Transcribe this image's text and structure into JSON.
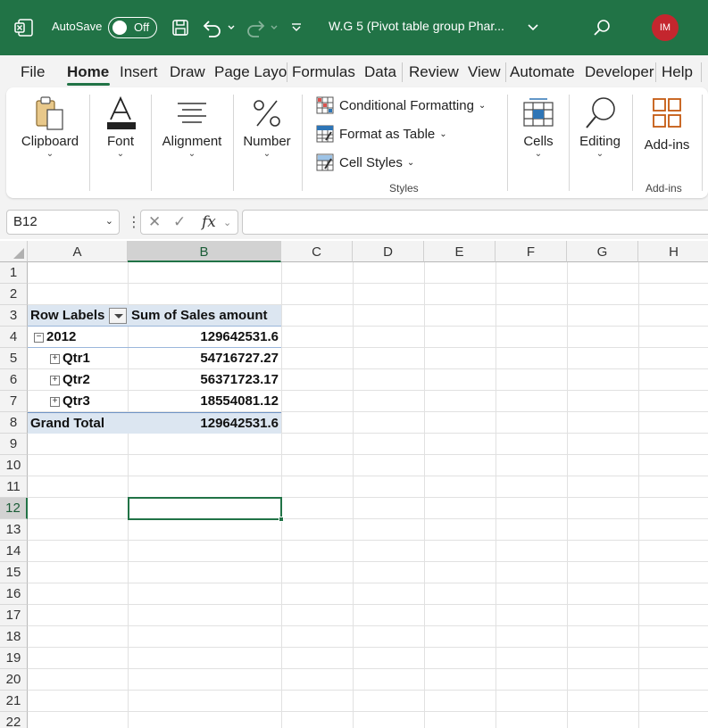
{
  "titlebar": {
    "autosave_label": "AutoSave",
    "autosave_state": "Off",
    "document_title": "W.G 5 (Pivot table group Phar...",
    "user_initials": "IM",
    "accent_color": "#217346",
    "avatar_color": "#c4262e"
  },
  "tabs": [
    "File",
    "Home",
    "Insert",
    "Draw",
    "Page Layo",
    "Formulas",
    "Data",
    "Review",
    "View",
    "Automate",
    "Developer",
    "Help"
  ],
  "active_tab": "Home",
  "ribbon": {
    "clipboard_label": "Clipboard",
    "font_label": "Font",
    "alignment_label": "Alignment",
    "number_label": "Number",
    "conditional_formatting_label": "Conditional Formatting",
    "format_as_table_label": "Format as Table",
    "cell_styles_label": "Cell Styles",
    "styles_group_label": "Styles",
    "cells_label": "Cells",
    "editing_label": "Editing",
    "addins_label": "Add-ins",
    "addins_group_label": "Add-ins"
  },
  "formula_bar": {
    "name_box": "B12",
    "fx_label": "fx",
    "formula": ""
  },
  "columns": [
    "A",
    "B",
    "C",
    "D",
    "E",
    "F",
    "G",
    "H"
  ],
  "selected_column": "B",
  "rows": [
    "1",
    "2",
    "3",
    "4",
    "5",
    "6",
    "7",
    "8",
    "9",
    "10",
    "11",
    "12",
    "13",
    "14",
    "15",
    "16",
    "17",
    "18",
    "19",
    "20",
    "21",
    "22"
  ],
  "selected_row": "12",
  "pivot": {
    "header_row_labels": "Row Labels",
    "header_value": "Sum of Sales amount",
    "year_label": "2012",
    "year_value": "129642531.6",
    "quarters": [
      {
        "label": "Qtr1",
        "value": "54716727.27"
      },
      {
        "label": "Qtr2",
        "value": "56371723.17"
      },
      {
        "label": "Qtr3",
        "value": "18554081.12"
      }
    ],
    "grand_total_label": "Grand Total",
    "grand_total_value": "129642531.6",
    "collapse_glyph": "−",
    "expand_glyph": "+"
  }
}
